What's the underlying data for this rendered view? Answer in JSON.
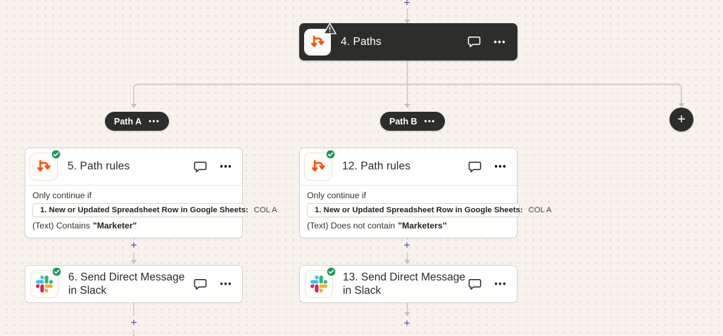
{
  "colors": {
    "background": "#f7f2ec",
    "node_dark": "#2d2e2c",
    "accent_orange": "#ff4f00",
    "success_green": "#149a57",
    "connector_plus": "#4a4eb5",
    "line_gray": "#ccc6bf"
  },
  "paths_node": {
    "title": "4. Paths",
    "icon": "paths-branch-icon",
    "has_warning": true,
    "menu_label": "•••"
  },
  "connectors": {
    "add_step_label": "+"
  },
  "add_path_label": "+",
  "columns": [
    {
      "pill": {
        "label": "Path A",
        "menu_label": "•••"
      },
      "rule_card": {
        "title": "5. Path rules",
        "menu_label": "•••",
        "intro": "Only continue if",
        "tag_label": "1. New or Updated Spreadsheet Row in Google Sheets:",
        "tag_value": "COL A",
        "condition_prefix": "(Text) Contains",
        "condition_value": "\"Marketer\""
      },
      "action_card": {
        "title": "6. Send Direct Message in Slack",
        "menu_label": "•••"
      }
    },
    {
      "pill": {
        "label": "Path B",
        "menu_label": "•••"
      },
      "rule_card": {
        "title": "12. Path rules",
        "menu_label": "•••",
        "intro": "Only continue if",
        "tag_label": "1. New or Updated Spreadsheet Row in Google Sheets:",
        "tag_value": "COL A",
        "condition_prefix": "(Text) Does not contain",
        "condition_value": "\"Marketers\""
      },
      "action_card": {
        "title": "13. Send Direct Message in Slack",
        "menu_label": "•••"
      }
    }
  ]
}
